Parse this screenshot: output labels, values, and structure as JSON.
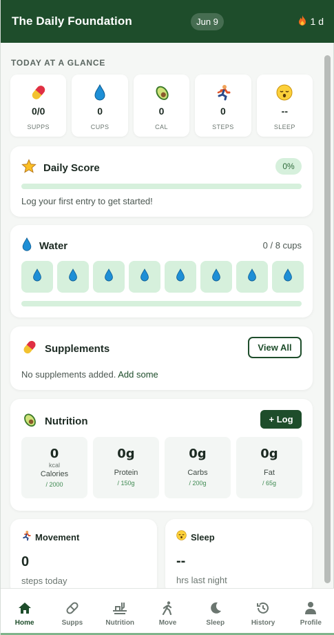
{
  "header": {
    "title": "The Daily Foundation",
    "date": "Jun 9",
    "streak": "1 d"
  },
  "glance": {
    "section_label": "TODAY AT A GLANCE",
    "items": [
      {
        "icon": "pill-icon",
        "value": "0/0",
        "label": "SUPPS"
      },
      {
        "icon": "droplet-icon",
        "value": "0",
        "label": "CUPS"
      },
      {
        "icon": "avocado-icon",
        "value": "0",
        "label": "CAL"
      },
      {
        "icon": "runner-icon",
        "value": "0",
        "label": "STEPS"
      },
      {
        "icon": "sleepy-face-icon",
        "value": "--",
        "label": "SLEEP"
      }
    ]
  },
  "score": {
    "title": "Daily Score",
    "badge": "0%",
    "progress": 0,
    "hint": "Log your first entry to get started!"
  },
  "water": {
    "title": "Water",
    "count": "0 / 8 cups",
    "cups_total": 8,
    "cups_filled": 0
  },
  "supplements": {
    "title": "Supplements",
    "button": "View All",
    "empty_text": "No supplements added.",
    "empty_link": "Add some"
  },
  "nutrition": {
    "title": "Nutrition",
    "button": "+ Log",
    "macros": [
      {
        "value": "0",
        "unit": "kcal",
        "name": "Calories",
        "goal": "/ 2000"
      },
      {
        "value": "0g",
        "unit": "",
        "name": "Protein",
        "goal": "/ 150g"
      },
      {
        "value": "0g",
        "unit": "",
        "name": "Carbs",
        "goal": "/ 200g"
      },
      {
        "value": "0g",
        "unit": "",
        "name": "Fat",
        "goal": "/ 65g"
      }
    ]
  },
  "movement": {
    "title": "Movement",
    "value": "0",
    "label": "steps today"
  },
  "sleep": {
    "title": "Sleep",
    "value": "--",
    "label": "hrs last night"
  },
  "nav": {
    "items": [
      {
        "label": "Home",
        "icon": "home-icon"
      },
      {
        "label": "Supps",
        "icon": "pill-icon"
      },
      {
        "label": "Nutrition",
        "icon": "utensils-icon"
      },
      {
        "label": "Move",
        "icon": "walking-icon"
      },
      {
        "label": "Sleep",
        "icon": "moon-icon"
      },
      {
        "label": "History",
        "icon": "history-icon"
      },
      {
        "label": "Profile",
        "icon": "person-icon"
      }
    ],
    "active": "Home"
  },
  "colors": {
    "brand": "#1e4d2b",
    "accent_light": "#d6f0dc",
    "water_blue": "#1e8fd6"
  }
}
